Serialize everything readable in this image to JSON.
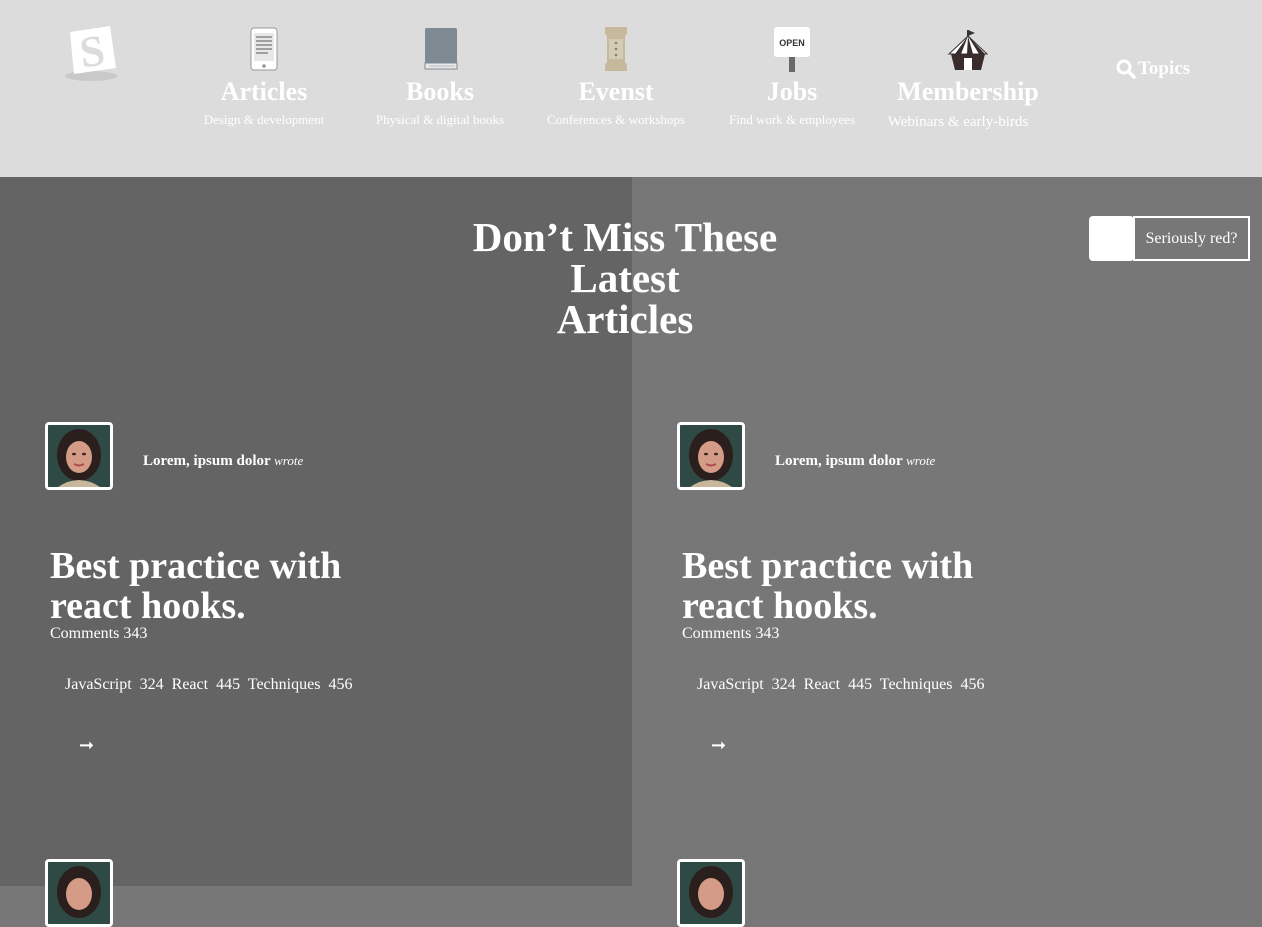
{
  "nav": {
    "items": [
      {
        "title": "Articles",
        "subtitle": "Design & development",
        "icon": "tablet-icon"
      },
      {
        "title": "Books",
        "subtitle": "Physical & digital books",
        "icon": "book-icon"
      },
      {
        "title": "Evenst",
        "subtitle": "Conferences & workshops",
        "icon": "ticket-icon"
      },
      {
        "title": "Jobs",
        "subtitle": "Find work & employees",
        "icon": "open-sign-icon",
        "sign_text": "OPEN"
      },
      {
        "title": "Membership",
        "subtitle": "Webinars & early-birds",
        "icon": "tent-icon"
      }
    ],
    "topics_label": "Topics"
  },
  "hero": {
    "headline_line1": "Don’t Miss These",
    "headline_line2": "Latest",
    "headline_line3": "Articles",
    "toggle_label": "Seriously red?"
  },
  "cards": [
    {
      "author": "Lorem, ipsum dolor",
      "verb": "wrote",
      "title_line1": "Best practice with",
      "title_line2": "react hooks.",
      "comments": "Comments 343",
      "tags": [
        {
          "name": "JavaScript",
          "count": "324"
        },
        {
          "name": "React",
          "count": "445"
        },
        {
          "name": "Techniques",
          "count": "456"
        }
      ],
      "arrow": "➞"
    },
    {
      "author": "Lorem, ipsum dolor",
      "verb": "wrote",
      "title_line1": "Best practice with",
      "title_line2": "react hooks.",
      "comments": "Comments 343",
      "tags": [
        {
          "name": "JavaScript",
          "count": "324"
        },
        {
          "name": "React",
          "count": "445"
        },
        {
          "name": "Techniques",
          "count": "456"
        }
      ],
      "arrow": "➞"
    }
  ],
  "colors": {
    "header_bg": "#dcdcdc",
    "left_panel": "#646464",
    "right_panel": "#777777",
    "text": "#ffffff"
  }
}
